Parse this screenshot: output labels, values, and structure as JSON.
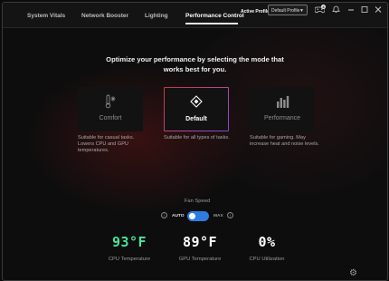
{
  "tabs": [
    {
      "label": "System Vitals",
      "active": false
    },
    {
      "label": "Network Booster",
      "active": false
    },
    {
      "label": "Lighting",
      "active": false
    },
    {
      "label": "Performance Control",
      "active": true
    }
  ],
  "header": {
    "active_profile_label": "Active Profile",
    "profile_value": "Default Profile",
    "notification_count": "4"
  },
  "heading": "Optimize your performance by selecting the mode that works best for you.",
  "modes": [
    {
      "label": "Comfort",
      "icon": "thermometer-snowflake-icon",
      "selected": false,
      "description": "Suitable for casual tasks. Lowers CPU and GPU temperatures."
    },
    {
      "label": "Default",
      "icon": "diamond-icon",
      "selected": true,
      "description": "Suitable for all types of tasks."
    },
    {
      "label": "Performance",
      "icon": "bars-icon",
      "selected": false,
      "description": "Suitable for gaming. May increase heat and noise levels."
    }
  ],
  "fan": {
    "title": "Fan Speed",
    "auto_label": "AUTO",
    "max_label": "MAX",
    "value": "AUTO"
  },
  "stats": [
    {
      "value": "93°F",
      "label": "CPU Temperature",
      "color": "#49e59a"
    },
    {
      "value": "89°F",
      "label": "GPU Temperature",
      "color": "#ffffff"
    },
    {
      "value": "0%",
      "label": "CPU Utilization",
      "color": "#ffffff"
    }
  ],
  "colors": {
    "accent_blue": "#2b7de1",
    "cpu_temp_green": "#49e59a",
    "selection_gradient_start": "#c23b3b",
    "selection_gradient_end": "#7a4ad6"
  }
}
